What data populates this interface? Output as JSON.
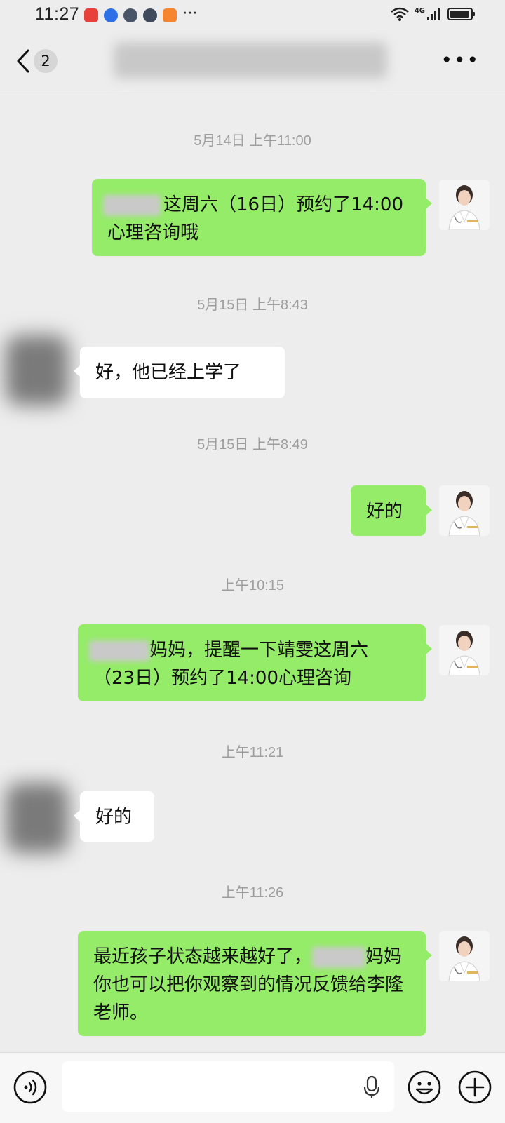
{
  "status_bar": {
    "time": "11:27",
    "network": "4G"
  },
  "header": {
    "back_count": "2",
    "title": "",
    "more_icon": "more-icon"
  },
  "messages": [
    {
      "type": "timestamp",
      "text": "5月14日 上午11:00"
    },
    {
      "type": "outgoing",
      "text": "这周六（16日）预约了14:00心理咨询哦"
    },
    {
      "type": "timestamp",
      "text": "5月15日 上午8:43"
    },
    {
      "type": "incoming",
      "text": "好，他已经上学了"
    },
    {
      "type": "timestamp",
      "text": "5月15日 上午8:49"
    },
    {
      "type": "outgoing",
      "text": "好的"
    },
    {
      "type": "timestamp",
      "text": "上午10:15"
    },
    {
      "type": "outgoing",
      "text_after_blur": "妈妈，提醒一下靖雯这周六",
      "text_line2": "（23日）预约了14:00心理咨询"
    },
    {
      "type": "timestamp",
      "text": "上午11:21"
    },
    {
      "type": "incoming",
      "text": "好的"
    },
    {
      "type": "timestamp",
      "text": "上午11:26"
    },
    {
      "type": "outgoing",
      "text_before_blur": "最近孩子状态越来越好了，",
      "text_after_blur": "妈",
      "text_rest": "妈你也可以把你观察到的情况反馈给李隆老师。"
    }
  ],
  "input_bar": {
    "voice_icon": "voice-icon",
    "mic_icon": "microphone-icon",
    "emoji_icon": "emoji-icon",
    "plus_icon": "plus-icon"
  },
  "colors": {
    "outgoing_bubble": "#95ec69",
    "incoming_bubble": "#ffffff",
    "background": "#ededed"
  }
}
